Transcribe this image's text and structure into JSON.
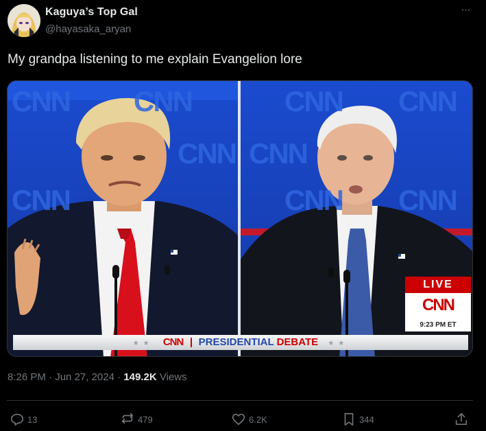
{
  "author": {
    "display_name": "Kaguya’s Top Gal",
    "handle": "@hayasaka_aryan"
  },
  "more_label": "···",
  "tweet_text": "My grandpa listening to me explain Evangelion lore",
  "media": {
    "background_watermark": "CNN",
    "live_label": "LIVE",
    "network_logo": "CNN",
    "time": "9:23 PM ET",
    "lower_third": {
      "network": "CNN",
      "title": "PRESIDENTIAL",
      "subtitle": "DEBATE"
    }
  },
  "meta": {
    "time": "8:26 PM",
    "separator": " · ",
    "date": "Jun 27, 2024",
    "views_count": "149.2K",
    "views_label": "Views"
  },
  "actions": {
    "replies": "13",
    "reposts": "479",
    "likes": "6.2K",
    "bookmarks": "344"
  },
  "colors": {
    "background": "#000000",
    "text": "#e7e9ea",
    "muted": "#71767b",
    "cnn_red": "#cc0000",
    "cnn_blue": "#1a45c0"
  },
  "icons": [
    "avatar",
    "more-icon",
    "reply-icon",
    "repost-icon",
    "like-icon",
    "bookmark-icon",
    "share-icon",
    "flag-pin-icon",
    "microphone-icon"
  ]
}
